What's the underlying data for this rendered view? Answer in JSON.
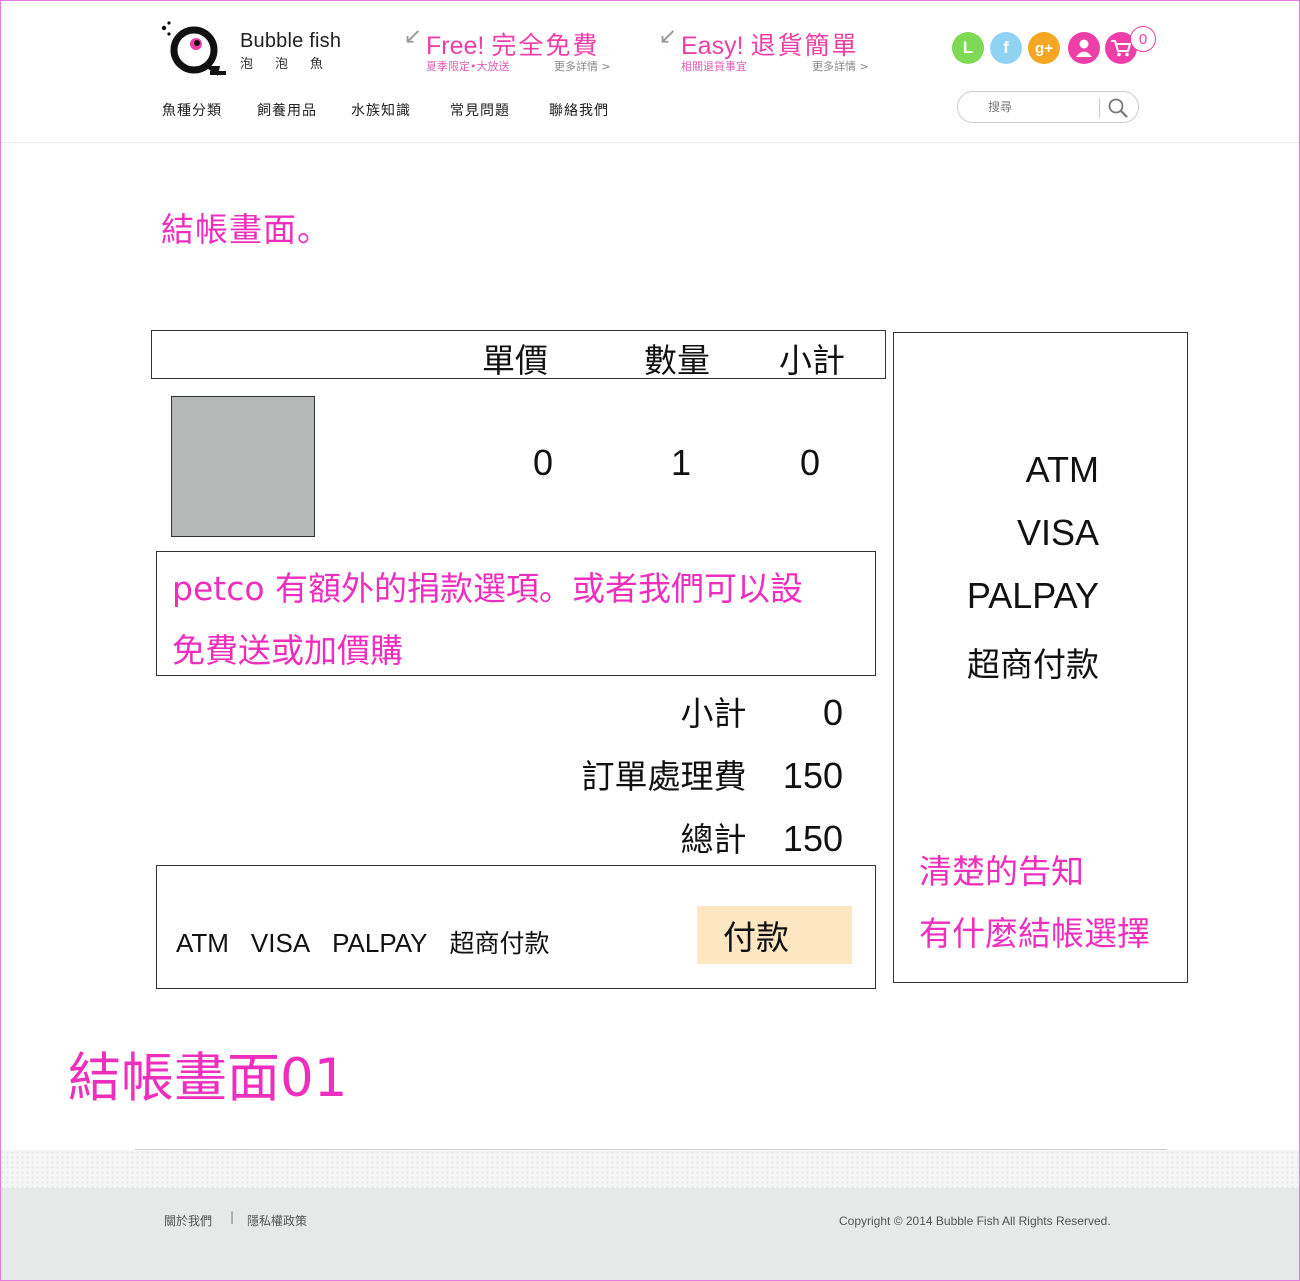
{
  "brand": {
    "name_en": "Bubble fish",
    "name_zh": "泡泡魚",
    "accent_color": "#ee3fa8"
  },
  "promos": [
    {
      "title_en": "Free!",
      "title_zh": "完全免費",
      "sub": "夏季限定•大放送",
      "more": "更多詳情 >"
    },
    {
      "title_en": "Easy!",
      "title_zh": "退貨簡單",
      "sub": "相關退貨事宜",
      "more": "更多詳情 >"
    }
  ],
  "header_icons": [
    {
      "name": "line-icon",
      "glyph": "L",
      "color": "#7ed957"
    },
    {
      "name": "facebook-icon",
      "glyph": "f",
      "color": "#8fd3f2"
    },
    {
      "name": "google-plus-icon",
      "glyph": "g+",
      "color": "#f5a623"
    },
    {
      "name": "user-icon",
      "glyph": "",
      "color": "#ee3fa8"
    },
    {
      "name": "cart-icon",
      "glyph": "",
      "color": "#ee3fa8"
    }
  ],
  "cart_count": "0",
  "nav": [
    "魚種分類",
    "飼養用品",
    "水族知識",
    "常見問題",
    "聯絡我們"
  ],
  "search": {
    "placeholder": "搜尋"
  },
  "page_note": "結帳畫面。",
  "table": {
    "headers": [
      "單價",
      "數量",
      "小計"
    ],
    "row": {
      "unit_price": "0",
      "quantity": "1",
      "subtotal": "0"
    }
  },
  "promo_note": {
    "line1": "petco 有額外的捐款選項。或者我們可以設",
    "line2": "免費送或加價購"
  },
  "summary": {
    "subtotal_label": "小計",
    "subtotal_value": "0",
    "fee_label": "訂單處理費",
    "fee_value": "150",
    "total_label": "總計",
    "total_value": "150"
  },
  "payment": {
    "methods": [
      "ATM",
      "VISA",
      "PALPAY",
      "超商付款"
    ],
    "pay_button": "付款"
  },
  "side_panel": {
    "options": [
      "ATM",
      "VISA",
      "PALPAY",
      "超商付款"
    ],
    "note_line1": "清楚的告知",
    "note_line2": "有什麼結帳選擇"
  },
  "big_title": "結帳畫面01",
  "footer": {
    "about": "關於我們",
    "separator": "|",
    "privacy": "隱私權政策",
    "copyright": "Copyright © 2014 Bubble Fish All Rights Reserved."
  }
}
